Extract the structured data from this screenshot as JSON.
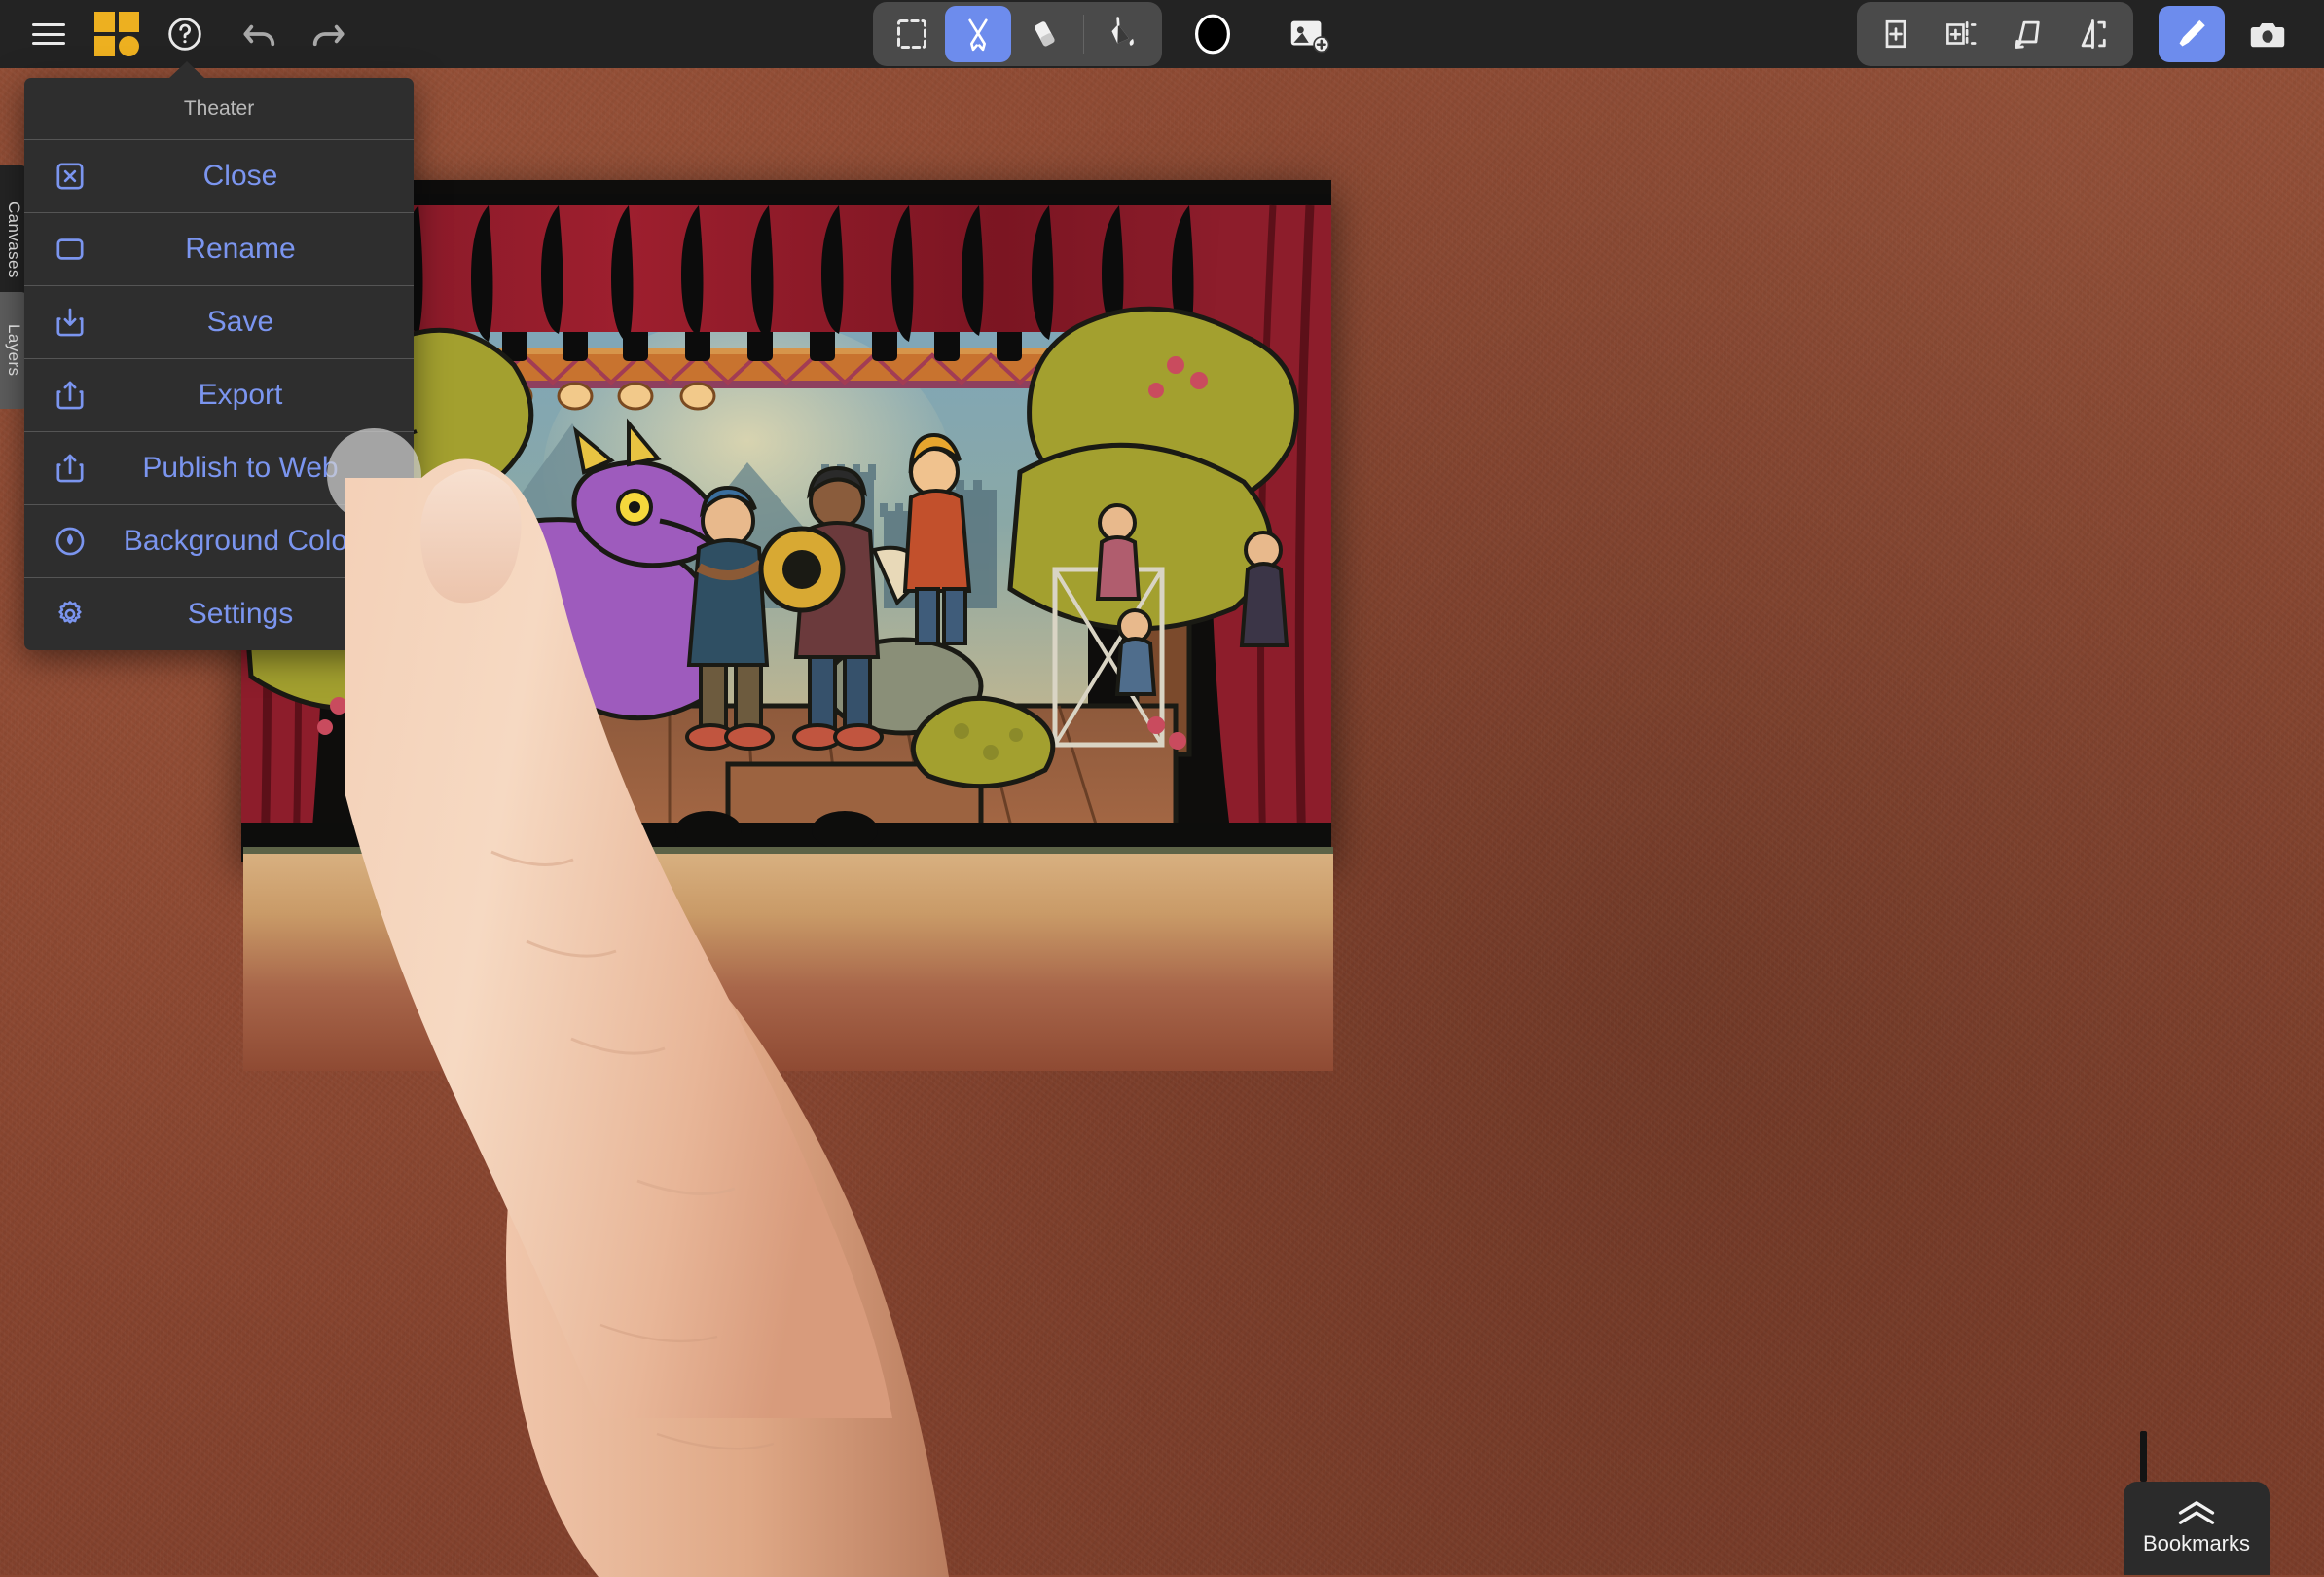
{
  "app": {
    "background_color": "#8a4630",
    "toolbar_bg": "#232323",
    "accent_color": "#6d8ced",
    "menu_text_color": "#7b95ef",
    "logo_color": "#edb020"
  },
  "toolbar": {
    "left": [
      {
        "name": "menu-button",
        "icon": "hamburger-icon",
        "label": "Menu"
      },
      {
        "name": "app-logo",
        "icon": "app-logo-icon",
        "label": "Paper"
      },
      {
        "name": "help-button",
        "icon": "question-mark-icon",
        "label": "Help"
      },
      {
        "name": "undo-button",
        "icon": "undo-arrow-icon",
        "label": "Undo"
      },
      {
        "name": "redo-button",
        "icon": "redo-arrow-icon",
        "label": "Redo"
      }
    ],
    "tools": [
      {
        "name": "select-tool",
        "icon": "dashed-square-icon",
        "label": "Select",
        "active": false
      },
      {
        "name": "pen-tool",
        "icon": "crossed-pens-icon",
        "label": "Draw",
        "active": true
      },
      {
        "name": "eraser-tool",
        "icon": "eraser-icon",
        "label": "Erase",
        "active": false
      },
      {
        "name": "fill-tool",
        "icon": "paint-bucket-icon",
        "label": "Fill",
        "active": false
      }
    ],
    "color_swatch": {
      "name": "color-swatch",
      "value": "#000000",
      "label": "Color"
    },
    "add_image": {
      "name": "add-image-button",
      "icon": "image-plus-icon",
      "label": "Add Image"
    },
    "page_tools": [
      {
        "name": "new-page-button",
        "icon": "page-plus-icon",
        "label": "New Page"
      },
      {
        "name": "duplicate-page-button",
        "icon": "page-duplicate-icon",
        "label": "Duplicate Page"
      },
      {
        "name": "rotate-page-button",
        "icon": "page-rotate-icon",
        "label": "Rotate Page"
      },
      {
        "name": "flip-page-button",
        "icon": "page-flip-icon",
        "label": "Flip Page"
      }
    ],
    "brush_button": {
      "name": "brush-button",
      "icon": "brush-icon",
      "label": "Brush",
      "active": true
    },
    "camera_button": {
      "name": "camera-button",
      "icon": "camera-icon",
      "label": "Camera",
      "active": false
    }
  },
  "side_tabs": [
    {
      "name": "sidebar-tab-canvases",
      "label": "Canvases",
      "active": true
    },
    {
      "name": "sidebar-tab-layers",
      "label": "Layers",
      "active": false
    }
  ],
  "menu": {
    "title": "Theater",
    "items": [
      {
        "label": "Close",
        "icon": "close-box-icon"
      },
      {
        "label": "Rename",
        "icon": "rectangle-icon"
      },
      {
        "label": "Save",
        "icon": "download-tray-icon"
      },
      {
        "label": "Export",
        "icon": "share-upload-icon"
      },
      {
        "label": "Publish to Web",
        "icon": "share-upload-icon"
      },
      {
        "label": "Background Color",
        "icon": "droplet-circle-icon"
      },
      {
        "label": "Settings",
        "icon": "gear-icon"
      }
    ]
  },
  "bookmarks": {
    "label": "Bookmarks",
    "icon": "double-chevron-up-icon"
  },
  "touch": {
    "name": "touch-indicator",
    "target_label": "Publish to Web"
  },
  "artwork": {
    "title": "Theater",
    "description": "Illustrated theater stage with red curtains, green trees, and costumed characters on a wooden stage"
  }
}
